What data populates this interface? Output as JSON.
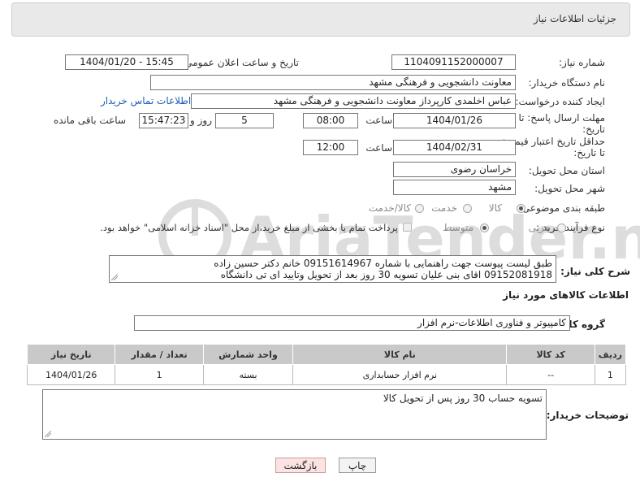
{
  "header": {
    "title": "جزئیات اطلاعات نیاز"
  },
  "form": {
    "need_number_label": "شماره نیاز:",
    "need_number": "1104091152000007",
    "announce_label": "تاریخ و ساعت اعلان عمومی:",
    "announce_value": "1404/01/20 - 15:45",
    "buyer_org_label": "نام دستگاه خریدار:",
    "buyer_org": "معاونت دانشجویی و فرهنگی مشهد",
    "requester_label": "ایجاد کننده درخواست:",
    "requester": "عباس اخلمدی کارپرداز معاونت دانشجویی و فرهنگی مشهد",
    "contact_link": "اطلاعات تماس خریدار",
    "deadline_label_1": "مهلت ارسال پاسخ: تا",
    "deadline_label_2": "تاریخ:",
    "deadline_date": "1404/01/26",
    "time_label": "ساعت",
    "deadline_time": "08:00",
    "days_value": "5",
    "days_label": "روز و",
    "remaining_time": "15:47:23",
    "remaining_label": "ساعت باقی مانده",
    "validity_label_1": "حداقل تاریخ اعتبار قیمت:",
    "validity_label_2": "تا تاریخ:",
    "validity_date": "1404/02/31",
    "validity_time": "12:00",
    "province_label": "استان محل تحویل:",
    "province": "خراسان رضوی",
    "city_label": "شهر محل تحویل:",
    "city": "مشهد",
    "category_label": "طبقه بندی موضوعی:",
    "category_options": [
      "کالا",
      "خدمت",
      "کالا/خدمت"
    ],
    "category_selected": "کالا",
    "process_label": "نوع فرآیند خرید :",
    "process_options": [
      "جزیی",
      "متوسط"
    ],
    "process_selected": "متوسط",
    "treasury_note": "پرداخت تمام یا بخشی از مبلغ خرید،از محل \"اسناد خزانه اسلامی\" خواهد بود."
  },
  "description": {
    "label": "شرح کلی نیاز:",
    "line1": "طبق لیست پیوست جهت راهنمایی با شماره 09151614967 خانم دکتر حسین زاده",
    "line2": "09152081918 اقای بنی علیان تسویه 30 روز بعد از تحویل وتایید ای تی دانشگاه"
  },
  "goods": {
    "section_title": "اطلاعات کالاهای مورد نیاز",
    "group_label": "گروه کالا:",
    "group_value": "کامپیوتر و فناوری اطلاعات-نرم افزار",
    "columns": [
      "ردیف",
      "کد کالا",
      "نام کالا",
      "واحد شمارش",
      "تعداد / مقدار",
      "تاریخ نیاز"
    ],
    "rows": [
      [
        "1",
        "--",
        "نرم افزار حسابداری",
        "بسته",
        "1",
        "1404/01/26"
      ]
    ]
  },
  "buyer_notes": {
    "label": "توضیحات خریدار:",
    "text": "تسویه حساب 30 روز پس از تحویل کالا"
  },
  "buttons": {
    "print": "چاپ",
    "back": "بازگشت"
  },
  "watermark": {
    "text": "AriaTender.neT"
  }
}
